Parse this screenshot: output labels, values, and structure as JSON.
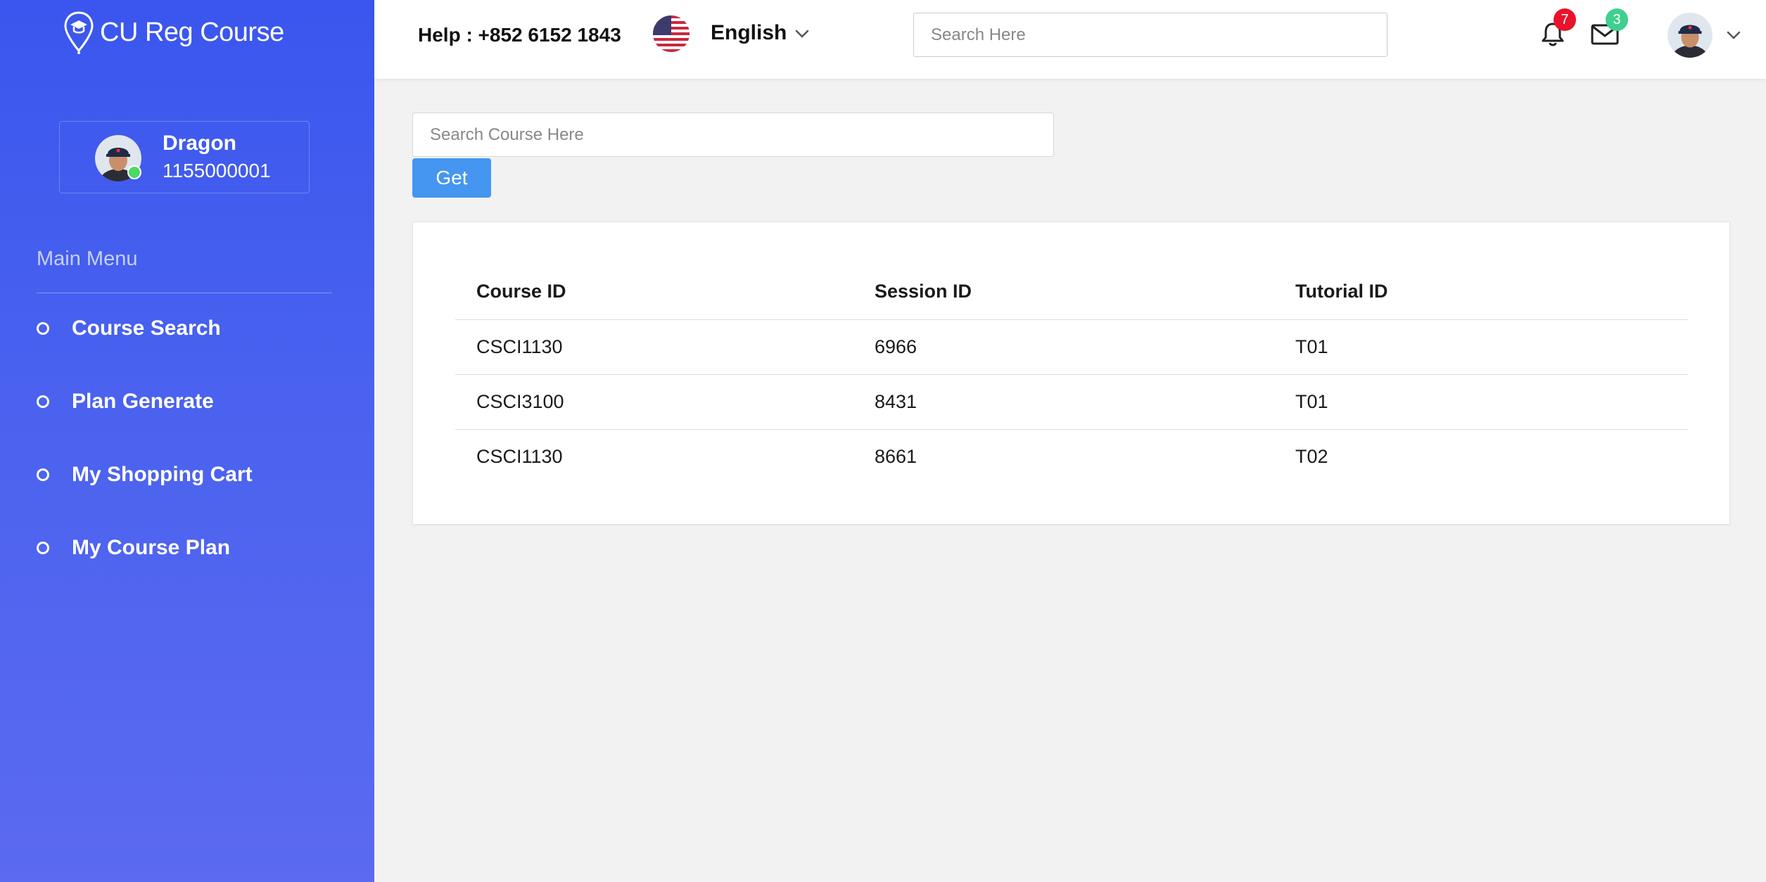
{
  "brand": {
    "name": "CU Reg Course"
  },
  "user": {
    "name": "Dragon",
    "id": "1155000001",
    "status_color": "#4cd964"
  },
  "sidebar": {
    "menu_title": "Main Menu",
    "items": [
      {
        "label": "Course Search"
      },
      {
        "label": "Plan Generate"
      },
      {
        "label": "My Shopping Cart"
      },
      {
        "label": "My Course Plan"
      }
    ]
  },
  "topbar": {
    "help": "Help : +852 6152 1843",
    "language": "English",
    "search_placeholder": "Search Here",
    "notifications_count": "7",
    "messages_count": "3"
  },
  "main": {
    "search_placeholder": "Search Course Here",
    "get_label": "Get",
    "table": {
      "headers": [
        "Course ID",
        "Session ID",
        "Tutorial ID"
      ],
      "rows": [
        [
          "CSCI1130",
          "6966",
          "T01"
        ],
        [
          "CSCI3100",
          "8431",
          "T01"
        ],
        [
          "CSCI1130",
          "8661",
          "T02"
        ]
      ]
    }
  },
  "colors": {
    "sidebar_top": "#3a56ee",
    "sidebar_bottom": "#5b6af0",
    "button": "#4596f0",
    "badge_red": "#e8132b",
    "badge_green": "#3fcf8e"
  }
}
